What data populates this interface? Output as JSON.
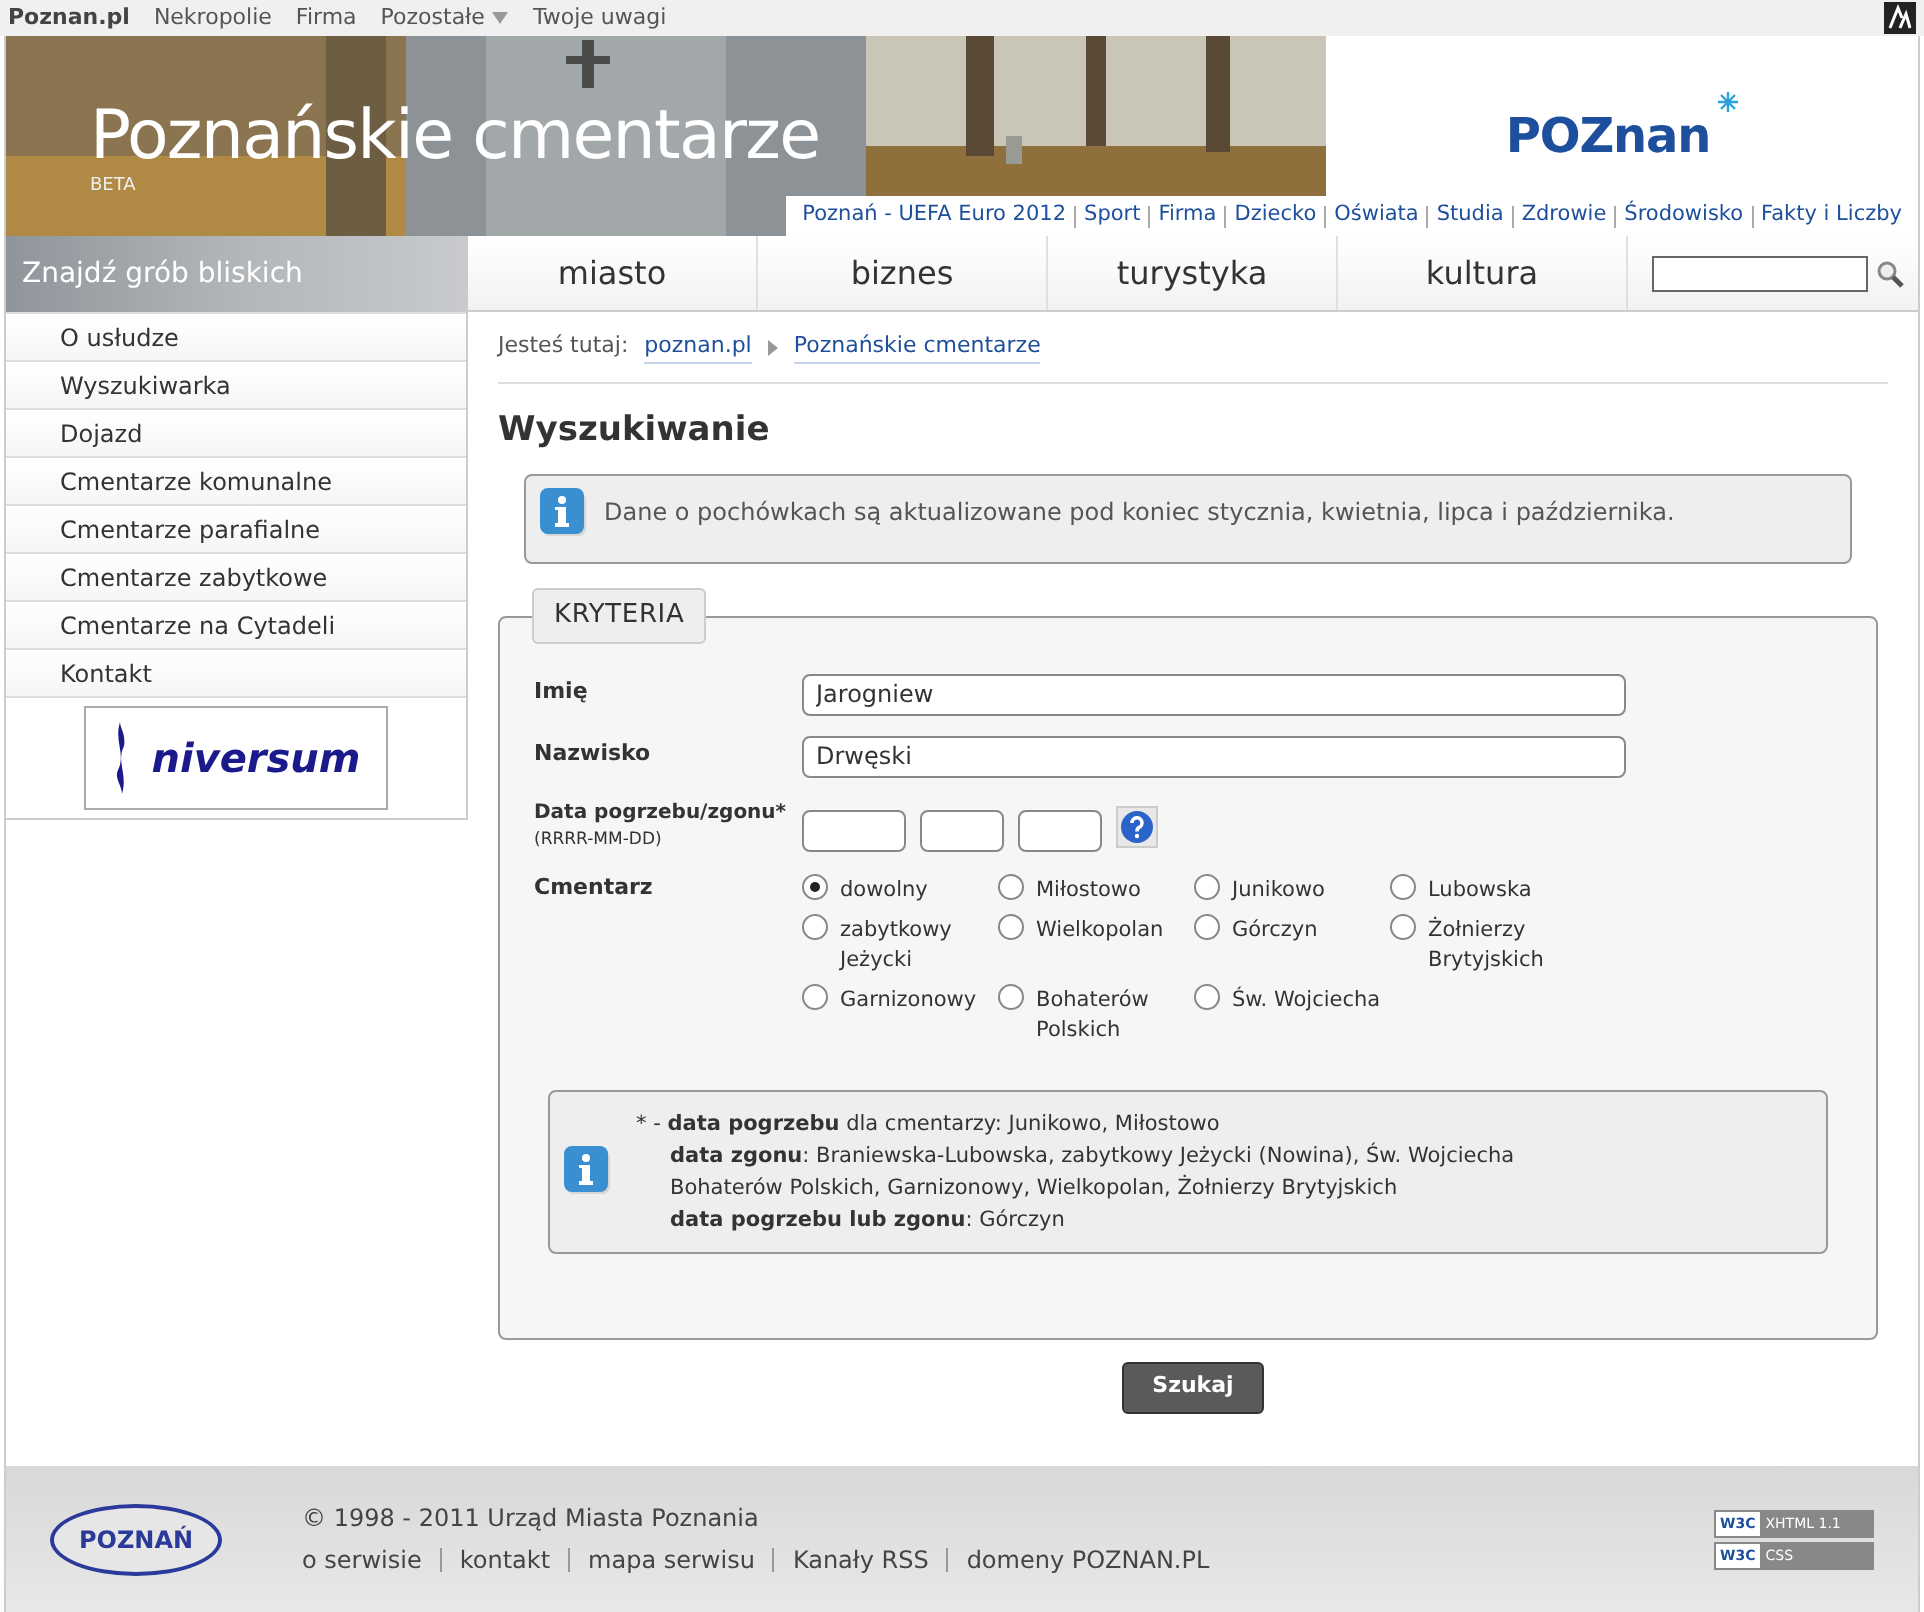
{
  "top_bar": {
    "links": [
      "Poznan.pl",
      "Nekropolie",
      "Firma",
      "Pozostałe",
      "Twoje uwagi"
    ]
  },
  "header": {
    "title": "Poznańskie cmentarze",
    "badge": "BETA",
    "logo": "POZnan",
    "links": [
      "Poznań - UEFA Euro 2012",
      "Sport",
      "Firma",
      "Dziecko",
      "Oświata",
      "Studia",
      "Zdrowie",
      "Środowisko",
      "Fakty i Liczby"
    ]
  },
  "sidebar": {
    "title": "Znajdź grób bliskich",
    "items": [
      "O usłudze",
      "Wyszukiwarka",
      "Dojazd",
      "Cmentarze komunalne",
      "Cmentarze parafialne",
      "Cmentarze zabytkowe",
      "Cmentarze na Cytadeli",
      "Kontakt"
    ],
    "banner": "niversum"
  },
  "nav": {
    "tabs": [
      "miasto",
      "biznes",
      "turystyka",
      "kultura"
    ]
  },
  "breadcrumb": {
    "label": "Jesteś tutaj:",
    "items": [
      "poznan.pl",
      "Poznańskie cmentarze"
    ]
  },
  "heading": "Wyszukiwanie",
  "notice": "Dane o pochówkach są aktualizowane pod koniec stycznia, kwietnia, lipca i października.",
  "criteria": {
    "legend": "KRYTERIA",
    "first_name": {
      "label": "Imię",
      "value": "Jarogniew"
    },
    "last_name": {
      "label": "Nazwisko",
      "value": "Drwęski"
    },
    "date": {
      "label": "Data pogrzebu/zgonu*",
      "hint": "(RRRR-MM-DD)"
    },
    "cemetery": {
      "label": "Cmentarz",
      "options": [
        {
          "label": "dowolny",
          "selected": true
        },
        {
          "label": "Miłostowo",
          "selected": false
        },
        {
          "label": "Junikowo",
          "selected": false
        },
        {
          "label": "Lubowska",
          "selected": false
        },
        {
          "label": "zabytkowy Jeżycki",
          "selected": false
        },
        {
          "label": "Wielkopolan",
          "selected": false
        },
        {
          "label": "Górczyn",
          "selected": false
        },
        {
          "label": "Żołnierzy Brytyjskich",
          "selected": false
        },
        {
          "label": "Garnizonowy",
          "selected": false
        },
        {
          "label": "Bohaterów Polskich",
          "selected": false
        },
        {
          "label": "Św. Wojciecha",
          "selected": false
        }
      ]
    },
    "footnote": [
      "* -  **data pogrzebu** dla cmentarzy: Junikowo, Miłostowo",
      "**data zgonu**: Braniewska-Lubowska, zabytkowy Jeżycki (Nowina), Św. Wojciecha",
      "Bohaterów Polskich, Garnizonowy, Wielkopolan, Żołnierzy Brytyjskich",
      "**data pogrzebu lub zgonu**: Górczyn"
    ]
  },
  "submit": "Szukaj",
  "footer": {
    "logo": "POZNAŃ",
    "copyright": "© 1998 - 2011 Urząd Miasta Poznania",
    "links": [
      "o serwisie",
      "kontakt",
      "mapa serwisu",
      "Kanały RSS",
      "domeny POZNAN.PL"
    ],
    "badges": [
      {
        "mark": "W3C",
        "label": "XHTML 1.1"
      },
      {
        "mark": "W3C",
        "label": "CSS"
      }
    ]
  }
}
